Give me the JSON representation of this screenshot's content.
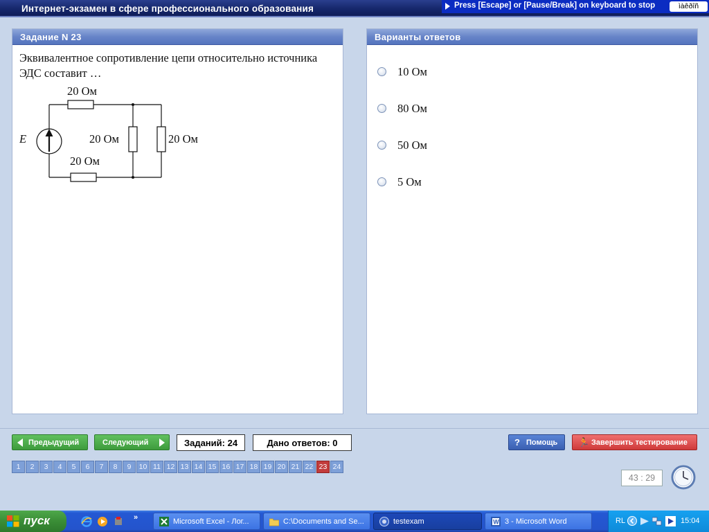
{
  "app": {
    "title": "Интернет-экзамен в сфере профессионального образования",
    "escape_hint": "Press [Escape] or [Pause/Break] on keyboard to stop",
    "lang_indicator": "ìàêðîñ"
  },
  "task": {
    "header": "Задание N 23",
    "question": "Эквивалентное сопротивление цепи относительно источника ЭДС составит …",
    "circuit": {
      "source_label": "E",
      "resistor_top": "20 Ом",
      "resistor_bottom": "20 Ом",
      "resistor_middle": "20 Ом",
      "resistor_right": "20 Ом"
    }
  },
  "answers": {
    "header": "Варианты ответов",
    "options": [
      "10 Ом",
      "80 Ом",
      "50 Ом",
      "5 Ом"
    ]
  },
  "controls": {
    "prev": "Предыдущий",
    "next": "Следующий",
    "tasks_count": "Заданий: 24",
    "answers_given": "Дано ответов: 0",
    "help": "Помощь",
    "finish": "Завершить тестирование"
  },
  "pager": {
    "pages": [
      "1",
      "2",
      "3",
      "4",
      "5",
      "6",
      "7",
      "8",
      "9",
      "10",
      "11",
      "12",
      "13",
      "14",
      "15",
      "16",
      "17",
      "18",
      "19",
      "20",
      "21",
      "22",
      "23",
      "24"
    ],
    "current": "23"
  },
  "timer": "43 : 29",
  "taskbar": {
    "start": "пуск",
    "quick_launch": [
      "ie-icon",
      "media-player-icon",
      "app-icon"
    ],
    "quick_launch_more": "»",
    "windows": [
      {
        "label": "Microsoft Excel - Лог...",
        "icon": "excel-icon",
        "active": false
      },
      {
        "label": "C:\\Documents and Se...",
        "icon": "folder-icon",
        "active": false
      },
      {
        "label": "testexam",
        "icon": "testexam-icon",
        "active": true
      },
      {
        "label": "3 - Microsoft Word",
        "icon": "word-icon",
        "active": false
      }
    ],
    "tray_lang": "RL",
    "time": "15:04"
  },
  "colors": {
    "panel_header": "#6784c8",
    "title_bar": "#16276b",
    "current_page": "#c23c3c",
    "green_button": "#3d9b3c",
    "red_button": "#cf3a3a"
  }
}
